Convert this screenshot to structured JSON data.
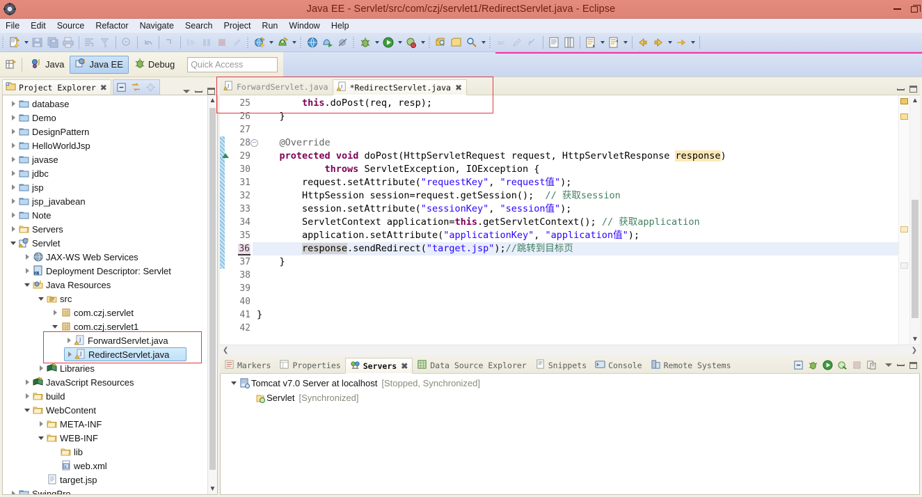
{
  "window": {
    "title": "Java EE - Servlet/src/com/czj/servlet1/RedirectServlet.java - Eclipse",
    "app_icon": "eclipse-icon",
    "minimize_label": "–",
    "restore_label": "restore",
    "close_label": "✕",
    "titlebar_color": "#e08b7d"
  },
  "menubar": {
    "items": [
      {
        "label": "File"
      },
      {
        "label": "Edit"
      },
      {
        "label": "Source"
      },
      {
        "label": "Refactor"
      },
      {
        "label": "Navigate"
      },
      {
        "label": "Search"
      },
      {
        "label": "Project"
      },
      {
        "label": "Run"
      },
      {
        "label": "Window"
      },
      {
        "label": "Help"
      }
    ]
  },
  "toolbar": {
    "groups": [
      {
        "items": [
          {
            "icon": "new-wizard-icon",
            "dropdown": true,
            "disabled": false
          },
          {
            "icon": "save-icon",
            "disabled": true
          },
          {
            "icon": "save-all-icon",
            "disabled": true
          },
          {
            "icon": "print-icon",
            "disabled": true
          }
        ]
      },
      {
        "items": [
          {
            "icon": "build-all-icon",
            "disabled": true
          },
          {
            "icon": "build-project-icon",
            "disabled": true
          }
        ]
      },
      {
        "items": [
          {
            "icon": "new-java-class-icon",
            "disabled": true
          },
          {
            "icon": "undo-icon",
            "disabled": true
          },
          {
            "icon": "redo-icon",
            "disabled": true
          }
        ]
      },
      {
        "items": [
          {
            "icon": "resume-icon",
            "disabled": true
          },
          {
            "icon": "suspend-icon",
            "disabled": true
          },
          {
            "icon": "terminate-icon",
            "disabled": true
          },
          {
            "icon": "disconnect-icon",
            "disabled": true
          }
        ]
      },
      {
        "items": [
          {
            "icon": "new-web-project-icon",
            "dropdown": true
          },
          {
            "icon": "new-server-icon",
            "dropdown": true
          }
        ]
      },
      {
        "items": [
          {
            "icon": "open-web-browser-icon"
          },
          {
            "icon": "run-on-server-icon"
          },
          {
            "icon": "skip-breakpoints-icon"
          }
        ]
      },
      {
        "items": [
          {
            "icon": "debug-icon",
            "dropdown": true
          },
          {
            "icon": "run-icon",
            "dropdown": true
          },
          {
            "icon": "external-tools-icon",
            "dropdown": true
          }
        ]
      },
      {
        "items": [
          {
            "icon": "open-type-icon"
          },
          {
            "icon": "open-task-icon"
          },
          {
            "icon": "search-icon",
            "dropdown": true
          }
        ]
      },
      {
        "items": [
          {
            "icon": "toggle-mark-occurrences-icon",
            "disabled": true
          },
          {
            "icon": "pencil-icon",
            "disabled": true
          },
          {
            "icon": "link-icon",
            "disabled": true
          }
        ]
      },
      {
        "items": [
          {
            "icon": "show-whitespace-icon"
          },
          {
            "icon": "block-selection-icon"
          }
        ]
      },
      {
        "items": [
          {
            "icon": "next-annotation-icon",
            "dropdown": true
          },
          {
            "icon": "previous-annotation-icon",
            "dropdown": true
          }
        ]
      },
      {
        "items": [
          {
            "icon": "back-icon",
            "dropdown": false
          },
          {
            "icon": "forward-icon",
            "dropdown": true
          },
          {
            "icon": "next-edit-icon",
            "dropdown": true
          }
        ]
      }
    ]
  },
  "perspective_bar": {
    "new_icon": "new-editor-icon",
    "buttons": [
      {
        "label": "Java",
        "icon": "java-perspective-icon",
        "active": false
      },
      {
        "label": "Java EE",
        "icon": "javaee-perspective-icon",
        "active": true
      },
      {
        "label": "Debug",
        "icon": "debug-perspective-icon",
        "active": false
      }
    ],
    "quick_access_placeholder": "Quick Access"
  },
  "project_explorer": {
    "tab_title": "Project Explorer",
    "tab_icon": "project-explorer-icon",
    "close_icon": "close-icon",
    "toolbar": [
      {
        "icon": "collapse-all-icon"
      },
      {
        "icon": "link-with-editor-icon"
      },
      {
        "icon": "focus-on-active-task-icon",
        "disabled": true
      }
    ],
    "view_menu_icon": "view-menu-icon",
    "minimize_icon": "minimize-icon",
    "maximize_icon": "maximize-icon",
    "highlight_color": "#e0393e",
    "tree": [
      {
        "label": "database",
        "indent": 0,
        "twist": "closed",
        "icon": "folder-blue-icon"
      },
      {
        "label": "Demo",
        "indent": 0,
        "twist": "closed",
        "icon": "folder-blue-icon"
      },
      {
        "label": "DesignPattern",
        "indent": 0,
        "twist": "closed",
        "icon": "folder-blue-icon"
      },
      {
        "label": "HelloWorldJsp",
        "indent": 0,
        "twist": "closed",
        "icon": "folder-blue-icon"
      },
      {
        "label": "javase",
        "indent": 0,
        "twist": "closed",
        "icon": "folder-blue-icon"
      },
      {
        "label": "jdbc",
        "indent": 0,
        "twist": "closed",
        "icon": "folder-blue-icon"
      },
      {
        "label": "jsp",
        "indent": 0,
        "twist": "closed",
        "icon": "folder-blue-icon"
      },
      {
        "label": "jsp_javabean",
        "indent": 0,
        "twist": "closed",
        "icon": "folder-blue-icon"
      },
      {
        "label": "Note",
        "indent": 0,
        "twist": "closed",
        "icon": "folder-blue-icon"
      },
      {
        "label": "Servers",
        "indent": 0,
        "twist": "closed",
        "icon": "folder-yellow-icon"
      },
      {
        "label": "Servlet",
        "indent": 0,
        "twist": "open",
        "icon": "dynamic-web-project-icon"
      },
      {
        "label": "JAX-WS Web Services",
        "indent": 1,
        "twist": "closed",
        "icon": "jaxws-icon"
      },
      {
        "label": "Deployment Descriptor: Servlet",
        "indent": 1,
        "twist": "closed",
        "icon": "deployment-descriptor-icon"
      },
      {
        "label": "Java Resources",
        "indent": 1,
        "twist": "open",
        "icon": "java-resources-icon"
      },
      {
        "label": "src",
        "indent": 2,
        "twist": "open",
        "icon": "source-folder-icon"
      },
      {
        "label": "com.czj.servlet",
        "indent": 3,
        "twist": "closed",
        "icon": "package-icon"
      },
      {
        "label": "com.czj.servlet1",
        "indent": 3,
        "twist": "open",
        "icon": "package-icon"
      },
      {
        "label": "ForwardServlet.java",
        "indent": 4,
        "twist": "closed",
        "icon": "java-file-warning-icon"
      },
      {
        "label": "RedirectServlet.java",
        "indent": 4,
        "twist": "closed",
        "icon": "java-file-warning-icon",
        "selected": true
      },
      {
        "label": "Libraries",
        "indent": 2,
        "twist": "closed",
        "icon": "libraries-icon"
      },
      {
        "label": "JavaScript Resources",
        "indent": 1,
        "twist": "closed",
        "icon": "libraries-icon"
      },
      {
        "label": "build",
        "indent": 1,
        "twist": "closed",
        "icon": "folder-yellow-icon"
      },
      {
        "label": "WebContent",
        "indent": 1,
        "twist": "open",
        "icon": "folder-yellow-icon"
      },
      {
        "label": "META-INF",
        "indent": 2,
        "twist": "closed",
        "icon": "folder-yellow-icon"
      },
      {
        "label": "WEB-INF",
        "indent": 2,
        "twist": "open",
        "icon": "folder-yellow-icon"
      },
      {
        "label": "lib",
        "indent": 3,
        "twist": "none",
        "icon": "folder-yellow-icon"
      },
      {
        "label": "web.xml",
        "indent": 3,
        "twist": "none",
        "icon": "xml-file-icon"
      },
      {
        "label": "target.jsp",
        "indent": 2,
        "twist": "none",
        "icon": "jsp-file-icon"
      },
      {
        "label": "SwingPro",
        "indent": 0,
        "twist": "closed",
        "icon": "folder-blue-icon"
      }
    ]
  },
  "editor": {
    "tabs": [
      {
        "label": "ForwardServlet.java",
        "icon": "java-file-warning-icon",
        "active": false,
        "dirty": false
      },
      {
        "label": "*RedirectServlet.java",
        "icon": "java-file-warning-icon",
        "active": true,
        "dirty": true,
        "close_icon": "close-icon"
      }
    ],
    "minimize_icon": "minimize-icon",
    "maximize_icon": "maximize-icon",
    "highlight_color": "#e0393e",
    "current_line": 36,
    "scroll_left_icon": "chevron-left-icon",
    "scroll_right_icon": "chevron-right-icon",
    "lines": [
      {
        "num": 25,
        "indent": 8,
        "text": "this.doPost(req, resp);"
      },
      {
        "num": 26,
        "indent": 4,
        "text": "}"
      },
      {
        "num": 27,
        "indent": 0,
        "text": ""
      },
      {
        "num": 28,
        "indent": 4,
        "text": "@Override",
        "folding": true
      },
      {
        "num": 29,
        "indent": 4,
        "text": "protected void doPost(HttpServletRequest request, HttpServletResponse response)",
        "marker": "override-arrow"
      },
      {
        "num": 30,
        "indent": 12,
        "text": "throws ServletException, IOException {"
      },
      {
        "num": 31,
        "indent": 8,
        "text": "request.setAttribute(\"requestKey\", \"request值\");"
      },
      {
        "num": 32,
        "indent": 8,
        "text": "HttpSession session=request.getSession();  // 获取session"
      },
      {
        "num": 33,
        "indent": 8,
        "text": "session.setAttribute(\"sessionKey\", \"session值\");"
      },
      {
        "num": 34,
        "indent": 8,
        "text": "ServletContext application=this.getServletContext(); // 获取application"
      },
      {
        "num": 35,
        "indent": 8,
        "text": "application.setAttribute(\"applicationKey\", \"application值\");"
      },
      {
        "num": 36,
        "indent": 8,
        "text": "response.sendRedirect(\"target.jsp\");//跳转到目标页",
        "current": true
      },
      {
        "num": 37,
        "indent": 4,
        "text": "}"
      },
      {
        "num": 38,
        "indent": 0,
        "text": ""
      },
      {
        "num": 39,
        "indent": 0,
        "text": ""
      },
      {
        "num": 40,
        "indent": 0,
        "text": ""
      },
      {
        "num": 41,
        "indent": 0,
        "text": "}"
      },
      {
        "num": 42,
        "indent": 0,
        "text": ""
      }
    ]
  },
  "bottom_panel": {
    "tabs": [
      {
        "label": "Markers",
        "icon": "markers-icon",
        "active": false
      },
      {
        "label": "Properties",
        "icon": "properties-icon",
        "active": false
      },
      {
        "label": "Servers",
        "icon": "servers-icon",
        "active": true,
        "close_icon": "close-icon"
      },
      {
        "label": "Data Source Explorer",
        "icon": "data-source-explorer-icon",
        "active": false
      },
      {
        "label": "Snippets",
        "icon": "snippets-icon",
        "active": false
      },
      {
        "label": "Console",
        "icon": "console-icon",
        "active": false
      },
      {
        "label": "Remote Systems",
        "icon": "remote-systems-icon",
        "active": false
      }
    ],
    "toolbar": [
      {
        "icon": "new-server-icon"
      },
      {
        "icon": "debug-server-icon"
      },
      {
        "icon": "start-server-icon"
      },
      {
        "icon": "profile-server-icon"
      },
      {
        "icon": "stop-server-icon",
        "disabled": true
      },
      {
        "icon": "publish-server-icon"
      }
    ],
    "view_menu_icon": "view-menu-icon",
    "minimize_icon": "minimize-icon",
    "maximize_icon": "maximize-icon",
    "servers": [
      {
        "name": "Tomcat v7.0 Server at localhost",
        "state": "[Stopped, Synchronized]",
        "icon": "server-icon",
        "twist": "open",
        "indent": 0
      },
      {
        "name": "Servlet",
        "state": "[Synchronized]",
        "icon": "module-icon",
        "twist": "none",
        "indent": 1
      }
    ]
  }
}
